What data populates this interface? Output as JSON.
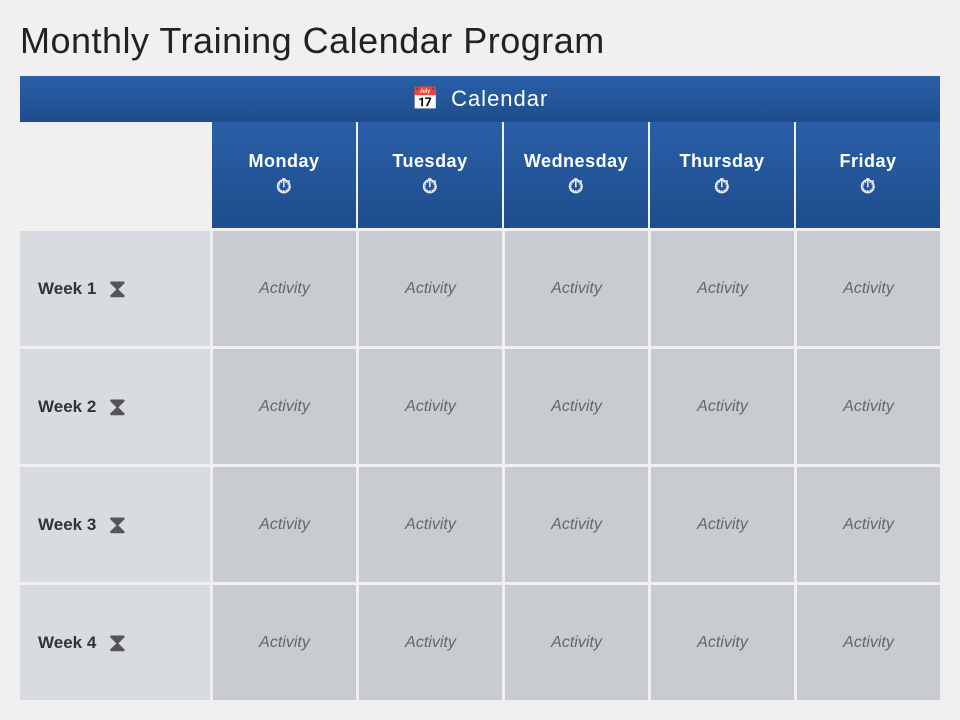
{
  "title": "Monthly Training Calendar Program",
  "header": {
    "icon": "📅",
    "label": "Calendar"
  },
  "days": [
    {
      "name": "Monday",
      "icon": "⏱"
    },
    {
      "name": "Tuesday",
      "icon": "⏱"
    },
    {
      "name": "Wednesday",
      "icon": "⏱"
    },
    {
      "name": "Thursday",
      "icon": "⏱"
    },
    {
      "name": "Friday",
      "icon": "⏱"
    }
  ],
  "weeks": [
    {
      "label": "Week 1",
      "activities": [
        "Activity",
        "Activity",
        "Activity",
        "Activity",
        "Activity"
      ]
    },
    {
      "label": "Week 2",
      "activities": [
        "Activity",
        "Activity",
        "Activity",
        "Activity",
        "Activity"
      ]
    },
    {
      "label": "Week 3",
      "activities": [
        "Activity",
        "Activity",
        "Activity",
        "Activity",
        "Activity"
      ]
    },
    {
      "label": "Week 4",
      "activities": [
        "Activity",
        "Activity",
        "Activity",
        "Activity",
        "Activity"
      ]
    }
  ]
}
